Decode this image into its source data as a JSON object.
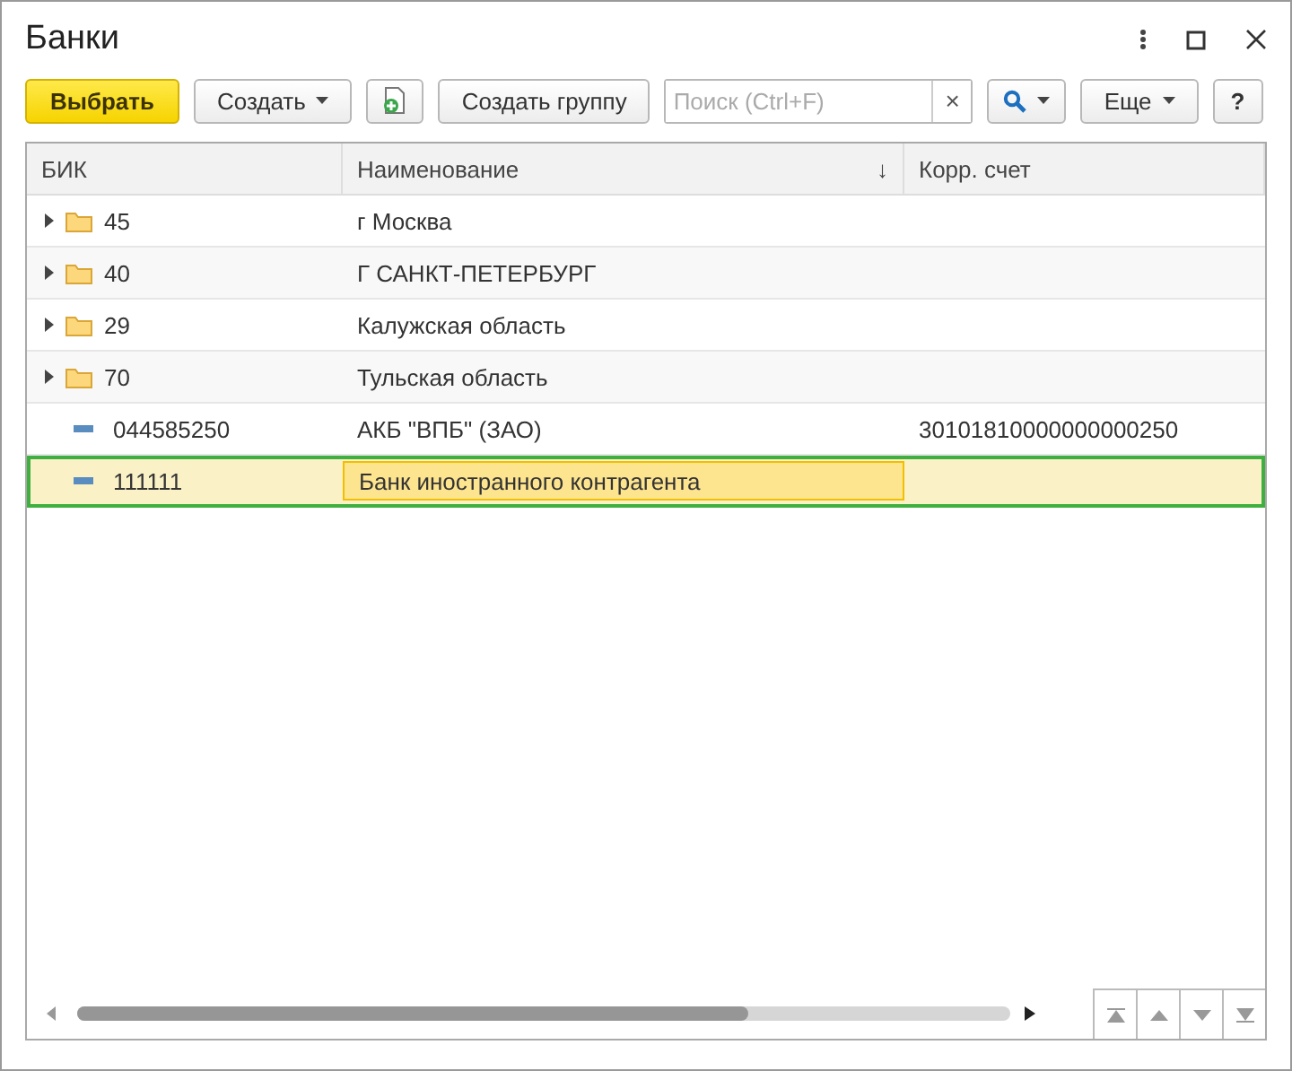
{
  "window": {
    "title": "Банки"
  },
  "toolbar": {
    "select_button": "Выбрать",
    "create_button": "Создать",
    "create_group_button": "Создать группу",
    "search": {
      "placeholder": "Поиск (Ctrl+F)",
      "clear": "×"
    },
    "more_button": "Еще",
    "help_button": "?"
  },
  "table": {
    "columns": [
      {
        "label": "БИК"
      },
      {
        "label": "Наименование",
        "sort": "↓"
      },
      {
        "label": "Корр. счет"
      }
    ],
    "rows": [
      {
        "kind": "group",
        "cells": [
          "45",
          "г Москва"
        ],
        "selected": false
      },
      {
        "kind": "group",
        "cells": [
          "40",
          "Г САНКТ-ПЕТЕРБУРГ"
        ],
        "selected": false
      },
      {
        "kind": "group",
        "cells": [
          "29",
          "Калужская область"
        ],
        "selected": false
      },
      {
        "kind": "group",
        "cells": [
          "70",
          "Тульская область"
        ],
        "selected": false
      },
      {
        "kind": "item",
        "cells": [
          "044585250",
          "АКБ \"ВПБ\" (ЗАО)",
          "30101810000000000250"
        ],
        "selected": false
      },
      {
        "kind": "item",
        "cells": [
          "111111",
          "Банк иностранного контрагента"
        ],
        "selected": true
      }
    ],
    "scroll": {
      "level": 0.72
    }
  }
}
